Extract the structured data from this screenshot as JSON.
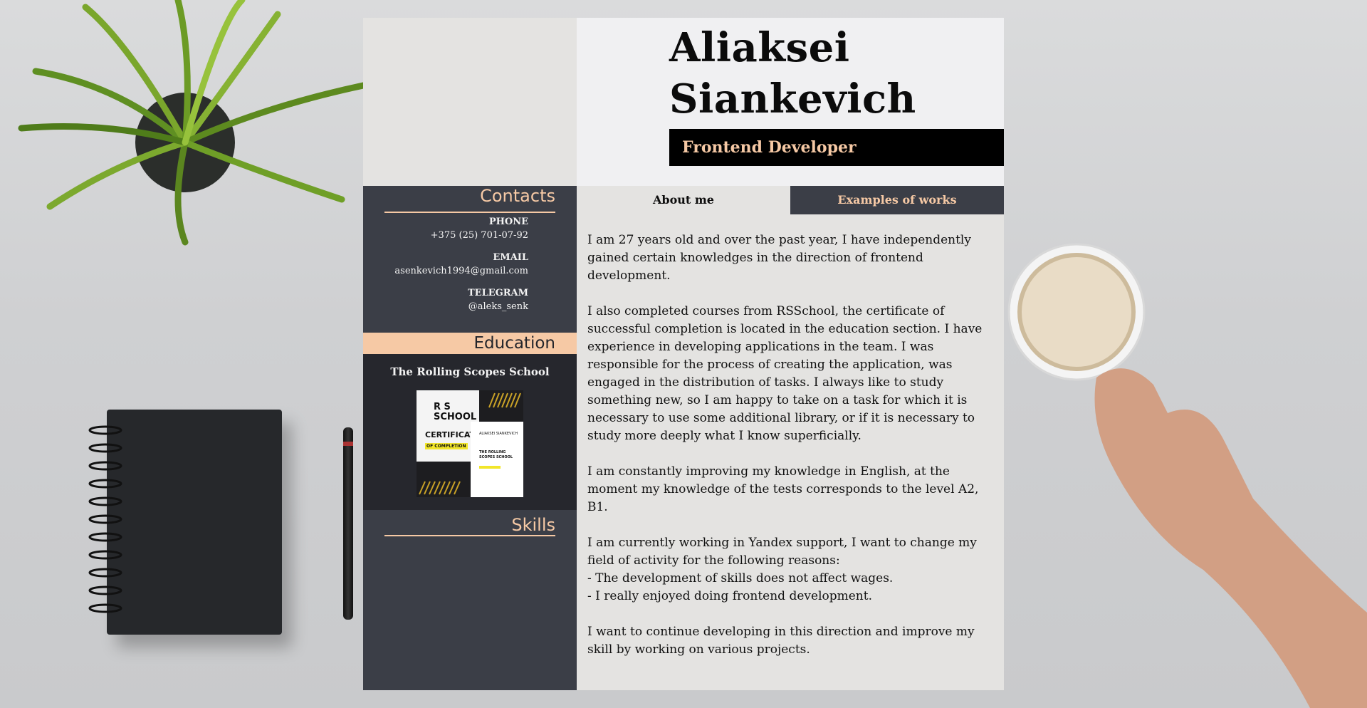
{
  "header": {
    "name_first": "Aliaksei",
    "name_last": "Siankevich",
    "role": "Frontend Developer"
  },
  "contacts": {
    "title": "Contacts",
    "phone_label": "PHONE",
    "phone_value": "+375 (25) 701-07-92",
    "email_label": "EMAIL",
    "email_value": "asenkevich1994@gmail.com",
    "telegram_label": "TELEGRAM",
    "telegram_value": "@aleks_senk"
  },
  "education": {
    "title": "Education",
    "school": "The Rolling Scopes School",
    "certificate": {
      "brand_line1": "R S",
      "brand_line2": "SCHOOL",
      "heading": "CERTIFICATE",
      "subheading": "OF COMPLETION",
      "recipient": "ALIAKSEI SIANKEVICH",
      "school_line": "THE ROLLING SCOPES SCHOOL"
    }
  },
  "skills": {
    "title": "Skills"
  },
  "tabs": {
    "about": "About me",
    "works": "Examples of works"
  },
  "about": {
    "p1": "I am 27 years old and over the past year, I have independently gained certain knowledges in the direction of frontend development.",
    "p2": "I also completed courses from RSSchool, the certificate of successful completion is located in the education section. I have experience in developing applications in the team. I was responsible for the process of creating the application, was engaged in the distribution of tasks. I always like to study something new, so I am happy to take on a task for which it is necessary to use some additional library, or if it is necessary to study more deeply what I know superficially.",
    "p3": "I am constantly improving my knowledge in English, at the moment my knowledge of the tests corresponds to the level A2, B1.",
    "p4_line1": "I am currently working in Yandex support, I want to change my field of activity for the following reasons:",
    "p4_line2": "- The development of skills does not affect wages.",
    "p4_line3": "- I really enjoyed doing frontend development.",
    "p5": "I want to continue developing in this direction and improve my skill by working on various projects."
  },
  "colors": {
    "accent": "#f6c9a5",
    "sidebar": "#3b3e47",
    "sidebar_dark": "#26272d",
    "page_light": "#e4e3e1",
    "header_bg": "#f0f0f2",
    "black": "#000000"
  }
}
